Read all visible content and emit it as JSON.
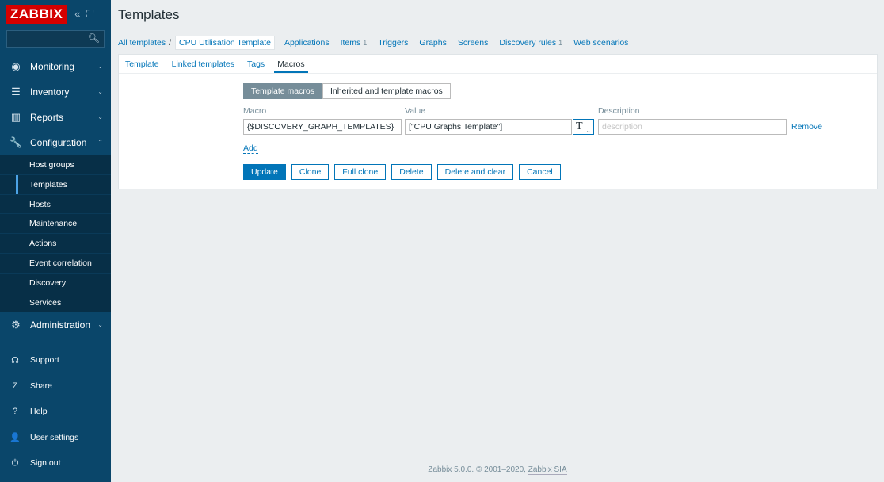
{
  "logo": "ZABBIX",
  "sidebar_controls": "« ⛶",
  "menu": [
    {
      "label": "Monitoring",
      "icon": "eye-icon",
      "glyph": "◉"
    },
    {
      "label": "Inventory",
      "icon": "list-icon",
      "glyph": "☰"
    },
    {
      "label": "Reports",
      "icon": "bar-chart-icon",
      "glyph": "▥"
    },
    {
      "label": "Configuration",
      "icon": "wrench-icon",
      "glyph": "🔧"
    }
  ],
  "config_sub": [
    "Host groups",
    "Templates",
    "Hosts",
    "Maintenance",
    "Actions",
    "Event correlation",
    "Discovery",
    "Services"
  ],
  "admin_label": "Administration",
  "bottom": [
    {
      "label": "Support",
      "icon": "headset-icon",
      "glyph": "☊"
    },
    {
      "label": "Share",
      "icon": "share-icon",
      "glyph": "Z"
    },
    {
      "label": "Help",
      "icon": "help-icon",
      "glyph": "?"
    },
    {
      "label": "User settings",
      "icon": "user-icon",
      "glyph": "👤"
    },
    {
      "label": "Sign out",
      "icon": "power-icon",
      "glyph": "⏻"
    }
  ],
  "page_title": "Templates",
  "breadcrumb": {
    "all": "All templates",
    "sep": "/",
    "current": "CPU Utilisation Template",
    "links": [
      {
        "label": "Applications",
        "count": ""
      },
      {
        "label": "Items",
        "count": "1"
      },
      {
        "label": "Triggers",
        "count": ""
      },
      {
        "label": "Graphs",
        "count": ""
      },
      {
        "label": "Screens",
        "count": ""
      },
      {
        "label": "Discovery rules",
        "count": "1"
      },
      {
        "label": "Web scenarios",
        "count": ""
      }
    ]
  },
  "tabs": [
    "Template",
    "Linked templates",
    "Tags",
    "Macros"
  ],
  "macro_toggle": {
    "template": "Template macros",
    "inherited": "Inherited and template macros"
  },
  "columns": {
    "macro": "Macro",
    "value": "Value",
    "description": "Description"
  },
  "macro_row": {
    "macro": "{$DISCOVERY_GRAPH_TEMPLATES}",
    "value": "[\"CPU Graphs Template\"]",
    "type_glyph": "T",
    "description_placeholder": "description",
    "remove": "Remove"
  },
  "add_label": "Add",
  "buttons": {
    "update": "Update",
    "clone": "Clone",
    "full_clone": "Full clone",
    "delete": "Delete",
    "delete_clear": "Delete and clear",
    "cancel": "Cancel"
  },
  "footer": {
    "text": "Zabbix 5.0.0. © 2001–2020,",
    "link": "Zabbix SIA"
  }
}
